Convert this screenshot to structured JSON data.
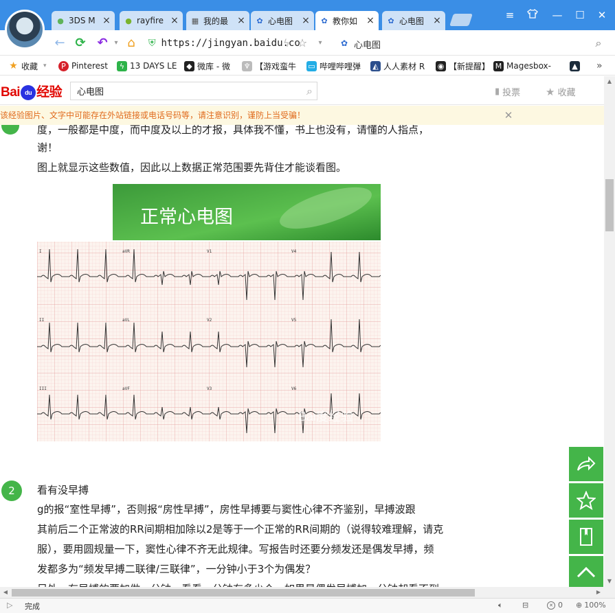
{
  "tabs": [
    {
      "label": "3DS M",
      "icon": "g-icon",
      "icon_color": "#5fb35a"
    },
    {
      "label": "rayfire",
      "icon": "rf-icon",
      "icon_color": "#7ab32e"
    },
    {
      "label": "我的最",
      "icon": "grid-icon",
      "icon_color": "#555555"
    },
    {
      "label": "心电图",
      "icon": "paw-icon",
      "icon_color": "#2e6cd1"
    },
    {
      "label": "教你如",
      "icon": "paw-icon",
      "icon_color": "#2e6cd1",
      "active": true
    },
    {
      "label": "心电图",
      "icon": "paw-icon",
      "icon_color": "#2e6cd1"
    }
  ],
  "address": {
    "url": "https://jingyan.baidu.co",
    "page_title": "心电图"
  },
  "bookmarks": [
    {
      "label": "收藏",
      "icon": "star-icon"
    },
    {
      "label": "Pinterest",
      "icon": "pinterest-icon",
      "color": "#d5202a"
    },
    {
      "label": "13 DAYS LE",
      "icon": "bolt-icon",
      "color": "#2eb34a"
    },
    {
      "label": "微库 - 微",
      "icon": "shield-icon",
      "color": "#222222"
    },
    {
      "label": "【游戏蛮牛",
      "icon": "horns-icon",
      "color": "#bbbbbb"
    },
    {
      "label": "哔哩哔哩弹",
      "icon": "tv-icon",
      "color": "#23ade5"
    },
    {
      "label": "人人素材 R",
      "icon": "rr-icon",
      "color": "#2b4e8c"
    },
    {
      "label": "【新提醒】",
      "icon": "alien-icon",
      "color": "#222222"
    },
    {
      "label": "Magesbox-",
      "icon": "m-icon",
      "color": "#222222"
    },
    {
      "label": "",
      "icon": "triangle-icon",
      "color": "#1a2a3a"
    }
  ],
  "header": {
    "logo_text_left": "Bai",
    "logo_text_paw": "du",
    "logo_text_right": "经验",
    "search_value": "心电图",
    "vote_label": "投票",
    "favorite_label": "收藏"
  },
  "warning": {
    "text": "该经验图片、文字中可能存在外站链接或电话号码等，请注意识别，谨防上当受骗！"
  },
  "content": {
    "para1_line1": "度，一般都是中度，而中度及以上的才报，具体我不懂，书上也没有，请懂的人指点，",
    "para1_line2": "谢！",
    "para2": "图上就显示这些数值，因此以上数据正常范围要先背住才能谈看图。",
    "image_title": "正常心电图",
    "image_watermark": "Bai度经验",
    "leads": [
      "I",
      "aVR",
      "V1",
      "V4",
      "II",
      "aVL",
      "V2",
      "V5",
      "III",
      "aVF",
      "V3",
      "V6"
    ],
    "step2_number": "2",
    "step2_title": "看有没早搏",
    "step2_lines": [
      "g的报“室性早搏”，否则报“房性早搏”，房性早搏要与窦性心律不齐鉴别，早搏波跟",
      "其前后二个正常波的RR间期相加除以2是等于一个正常的RR间期的（说得较难理解，请克",
      "服），要用圆规量一下，窦性心律不齐无此规律。写报告时还要分频发还是偶发早搏，频",
      "发都多为“频发早搏二联律/三联律”，一分钟小于3个为偶发？",
      "另外，有早搏的要加做一分钟，看看一分钟有多少个，如果是偶发早搏加一分钟却看不到"
    ]
  },
  "status": {
    "text": "完成",
    "count": "0",
    "zoom": "100%"
  }
}
